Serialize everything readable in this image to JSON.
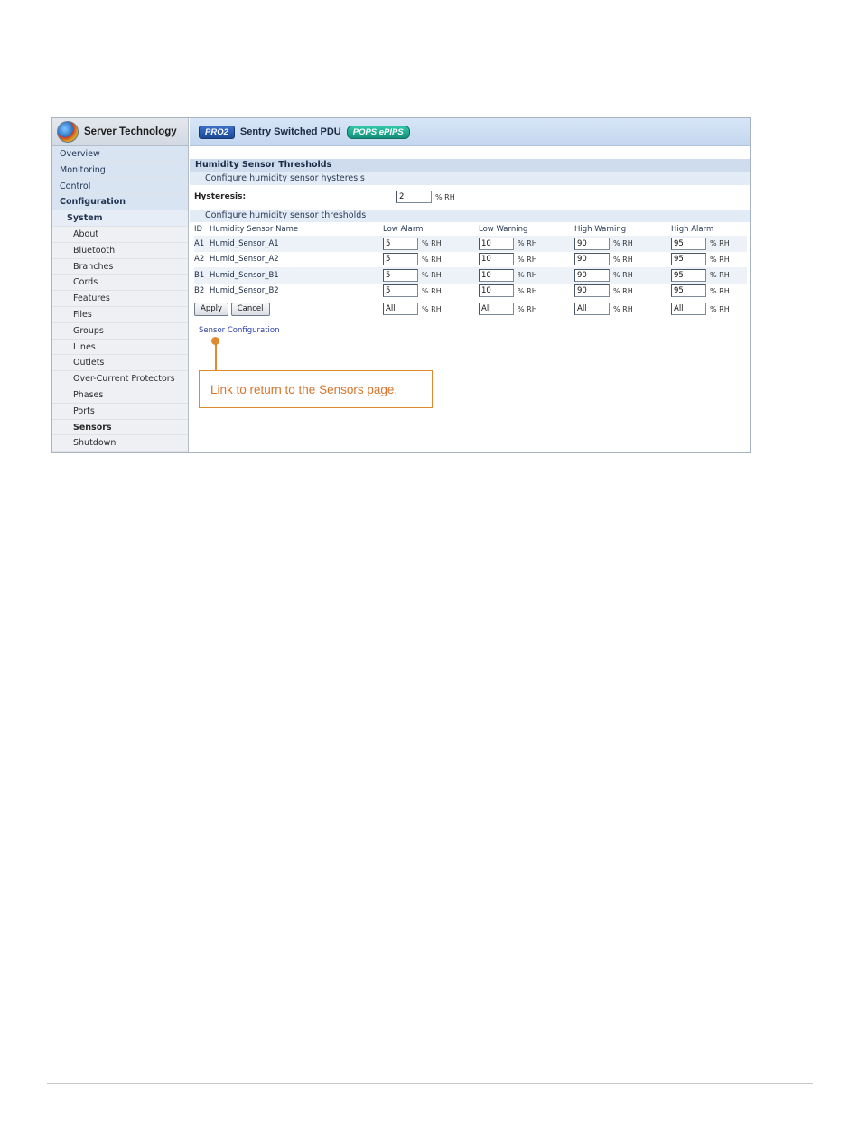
{
  "sidebar": {
    "brand": "Server Technology",
    "items": [
      {
        "label": "Overview"
      },
      {
        "label": "Monitoring"
      },
      {
        "label": "Control"
      },
      {
        "label": "Configuration"
      },
      {
        "label": "System"
      },
      {
        "label": "About"
      },
      {
        "label": "Bluetooth"
      },
      {
        "label": "Branches"
      },
      {
        "label": "Cords"
      },
      {
        "label": "Features"
      },
      {
        "label": "Files"
      },
      {
        "label": "Groups"
      },
      {
        "label": "Lines"
      },
      {
        "label": "Outlets"
      },
      {
        "label": "Over-Current Protectors"
      },
      {
        "label": "Phases"
      },
      {
        "label": "Ports"
      },
      {
        "label": "Sensors"
      },
      {
        "label": "Shutdown"
      }
    ]
  },
  "header": {
    "pro_badge": "PRO2",
    "product": "Sentry Switched PDU",
    "pops_badge": "POPS ePIPS"
  },
  "main": {
    "section_title": "Humidity Sensor Thresholds",
    "hysteresis_header": "Configure humidity sensor hysteresis",
    "hysteresis_label": "Hysteresis:",
    "hysteresis_value": "2",
    "unit": "% RH",
    "thresholds_header": "Configure humidity sensor thresholds",
    "columns": [
      "ID",
      "Humidity Sensor Name",
      "Low Alarm",
      "Low Warning",
      "High Warning",
      "High Alarm"
    ],
    "rows": [
      {
        "id": "A1",
        "name": "Humid_Sensor_A1",
        "low_alarm": "5",
        "low_warning": "10",
        "high_warning": "90",
        "high_alarm": "95"
      },
      {
        "id": "A2",
        "name": "Humid_Sensor_A2",
        "low_alarm": "5",
        "low_warning": "10",
        "high_warning": "90",
        "high_alarm": "95"
      },
      {
        "id": "B1",
        "name": "Humid_Sensor_B1",
        "low_alarm": "5",
        "low_warning": "10",
        "high_warning": "90",
        "high_alarm": "95"
      },
      {
        "id": "B2",
        "name": "Humid_Sensor_B2",
        "low_alarm": "5",
        "low_warning": "10",
        "high_warning": "90",
        "high_alarm": "95"
      }
    ],
    "all_row": {
      "low_alarm": "All",
      "low_warning": "All",
      "high_warning": "All",
      "high_alarm": "All"
    },
    "apply_label": "Apply",
    "cancel_label": "Cancel",
    "sensor_config_link": "Sensor Configuration"
  },
  "callout": {
    "text": "Link to return to the Sensors page.",
    "color": "#e0892f"
  }
}
